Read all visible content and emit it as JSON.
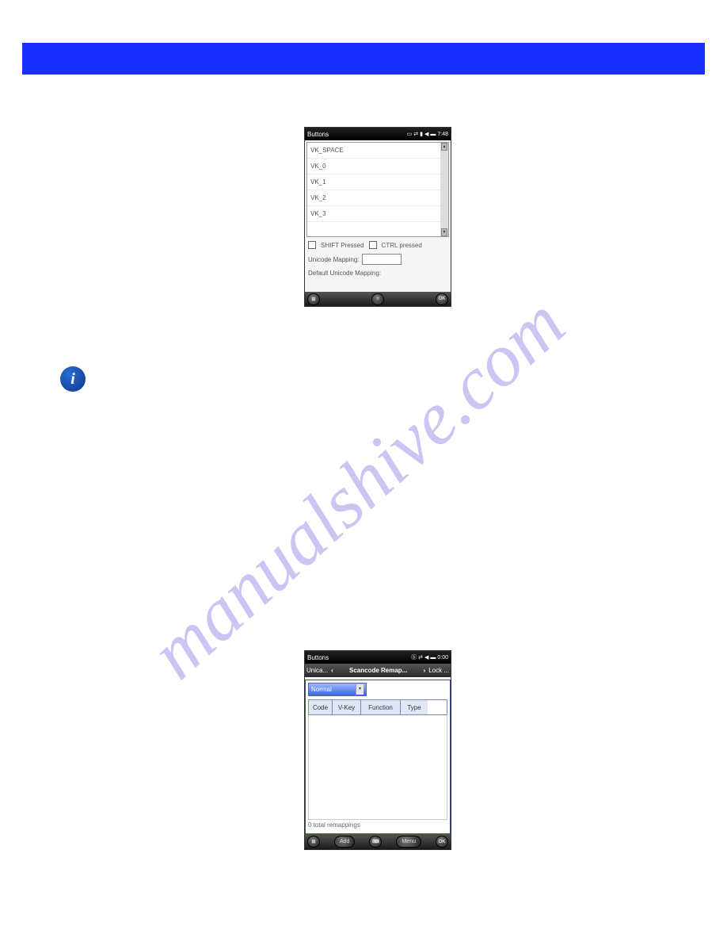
{
  "watermark": "manualshive.com",
  "info_tooltip": "i",
  "screenshot1": {
    "titlebar": {
      "title": "Buttons",
      "time": "7:48"
    },
    "list": [
      "VK_SPACE",
      "VK_0",
      "VK_1",
      "VK_2",
      "VK_3"
    ],
    "check_shift": "SHIFT Pressed",
    "check_ctrl": "CTRL pressed",
    "unicode_label": "Unicode Mapping:",
    "default_label": "Default Unicode Mapping:",
    "ok": "OK"
  },
  "screenshot2": {
    "titlebar": {
      "title": "Buttons",
      "time": "0:00"
    },
    "tabs": {
      "left": "Unica...",
      "center": "Scancode Remap...",
      "right": "Lock ..."
    },
    "dropdown_value": "Normal",
    "columns": [
      "Code",
      "V-Key",
      "Function",
      "Type"
    ],
    "footer": "0 total remappings",
    "buttons": {
      "add": "Add",
      "menu": "Menu",
      "ok": "OK"
    }
  }
}
